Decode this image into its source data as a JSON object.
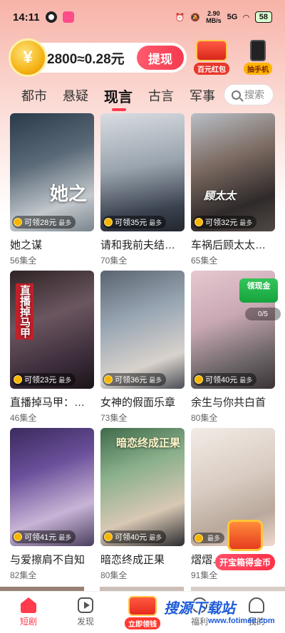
{
  "status_bar": {
    "time": "14:11",
    "net_speed_value": "2.90",
    "net_speed_unit": "MB/s",
    "signal": "5G",
    "battery": "58"
  },
  "header": {
    "coin_symbol": "¥",
    "coin_balance": "2800≈0.28元",
    "withdraw_label": "提现",
    "promos": [
      {
        "label": "百元红包",
        "icon": "red-envelope-icon"
      },
      {
        "label": "抽手机",
        "icon": "phone-icon"
      }
    ]
  },
  "tabs": {
    "items": [
      "都市",
      "悬疑",
      "现言",
      "古言",
      "军事"
    ],
    "active_index": 2,
    "search_placeholder": "搜索"
  },
  "dramas": [
    {
      "title": "她之谋",
      "episodes": "56集全",
      "reward": "可领28元",
      "reward_suffix": "最多",
      "poster_text": "她之"
    },
    {
      "title": "请和我前夫结…",
      "episodes": "70集全",
      "reward": "可领35元",
      "reward_suffix": "最多",
      "poster_text": ""
    },
    {
      "title": "车祸后顾太太…",
      "episodes": "65集全",
      "reward": "可领32元",
      "reward_suffix": "最多",
      "poster_text": "顾太太"
    },
    {
      "title": "直播掉马甲：…",
      "episodes": "46集全",
      "reward": "可领23元",
      "reward_suffix": "最多",
      "poster_text": "直播掉马甲"
    },
    {
      "title": "女神的假面乐章",
      "episodes": "73集全",
      "reward": "可领36元",
      "reward_suffix": "最多",
      "poster_text": ""
    },
    {
      "title": "余生与你共白首",
      "episodes": "80集全",
      "reward": "可领40元",
      "reward_suffix": "最多",
      "poster_text": ""
    },
    {
      "title": "与爱擦肩不自知",
      "episodes": "82集全",
      "reward": "可领41元",
      "reward_suffix": "最多",
      "poster_text": ""
    },
    {
      "title": "暗恋终成正果",
      "episodes": "80集全",
      "reward": "可领40元",
      "reward_suffix": "最多",
      "poster_text": "暗恋终成正果"
    },
    {
      "title": "熠熠…",
      "episodes": "91集全",
      "reward": "",
      "reward_suffix": "最多",
      "poster_text": ""
    }
  ],
  "floating": {
    "cash_badge": "领现金",
    "progress": "0/5",
    "treasure_label": "开宝箱得金币"
  },
  "bottom_nav": {
    "items": [
      {
        "label": "短剧",
        "icon": "home-icon",
        "active": true
      },
      {
        "label": "发现",
        "icon": "play-icon",
        "active": false
      },
      {
        "label": "立即领钱",
        "icon": "gift-icon",
        "active": false
      },
      {
        "label": "福利",
        "icon": "welfare-icon",
        "active": false
      },
      {
        "label": "我的",
        "icon": "me-icon",
        "active": false
      }
    ]
  },
  "watermark": {
    "text": "搜源下载站",
    "url": "www.fotimeit.com"
  },
  "colors": {
    "accent": "#ff3b4e",
    "coin": "#f5b417"
  }
}
